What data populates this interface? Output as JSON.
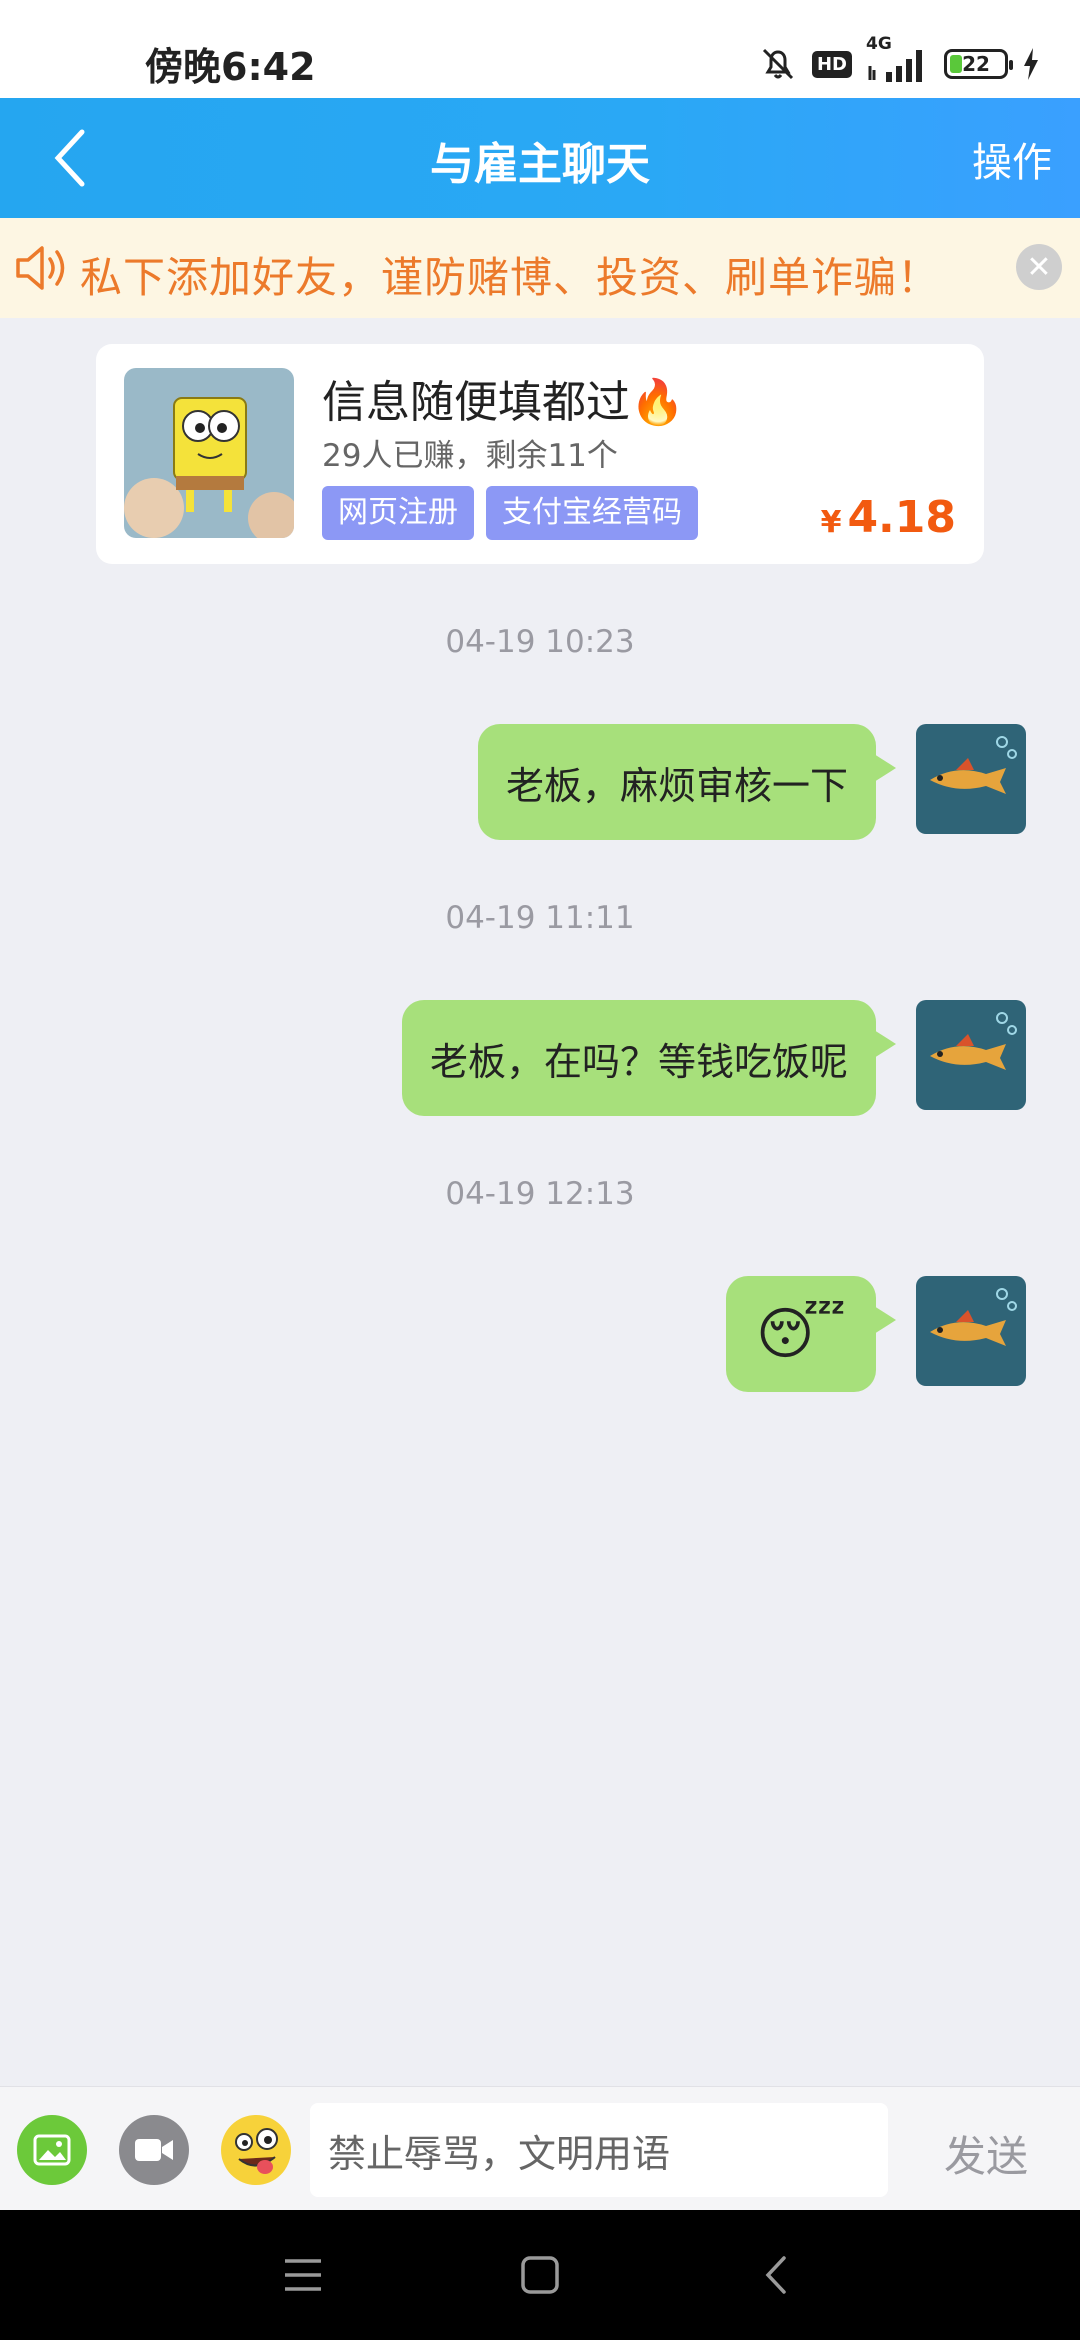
{
  "status_bar": {
    "time": "傍晚6:42",
    "hd": "HD",
    "network": "4G",
    "battery": "22",
    "battery_level": 0.22
  },
  "header": {
    "title": "与雇主聊天",
    "action": "操作"
  },
  "warning": {
    "text": "私下添加好友，谨防赌博、投资、刷单诈骗！"
  },
  "task": {
    "title": "信息随便填都过🔥",
    "subtitle": "29人已赚，剩余11个",
    "tags": [
      "网页注册",
      "支付宝经营码"
    ],
    "currency": "¥",
    "price": "4.18"
  },
  "messages": [
    {
      "time": "04-19 10:23",
      "text": "老板，麻烦审核一下"
    },
    {
      "time": "04-19 11:11",
      "text": "老板，在吗？等钱吃饭呢"
    },
    {
      "time": "04-19 12:13",
      "text": "😴"
    }
  ],
  "input": {
    "placeholder": "禁止辱骂，文明用语",
    "send": "发送"
  },
  "colors": {
    "header": "#2aa8f5",
    "warning_text": "#ec7a2b",
    "bubble": "#a7e07b",
    "tag": "#8c98f5",
    "price": "#f25a10"
  }
}
